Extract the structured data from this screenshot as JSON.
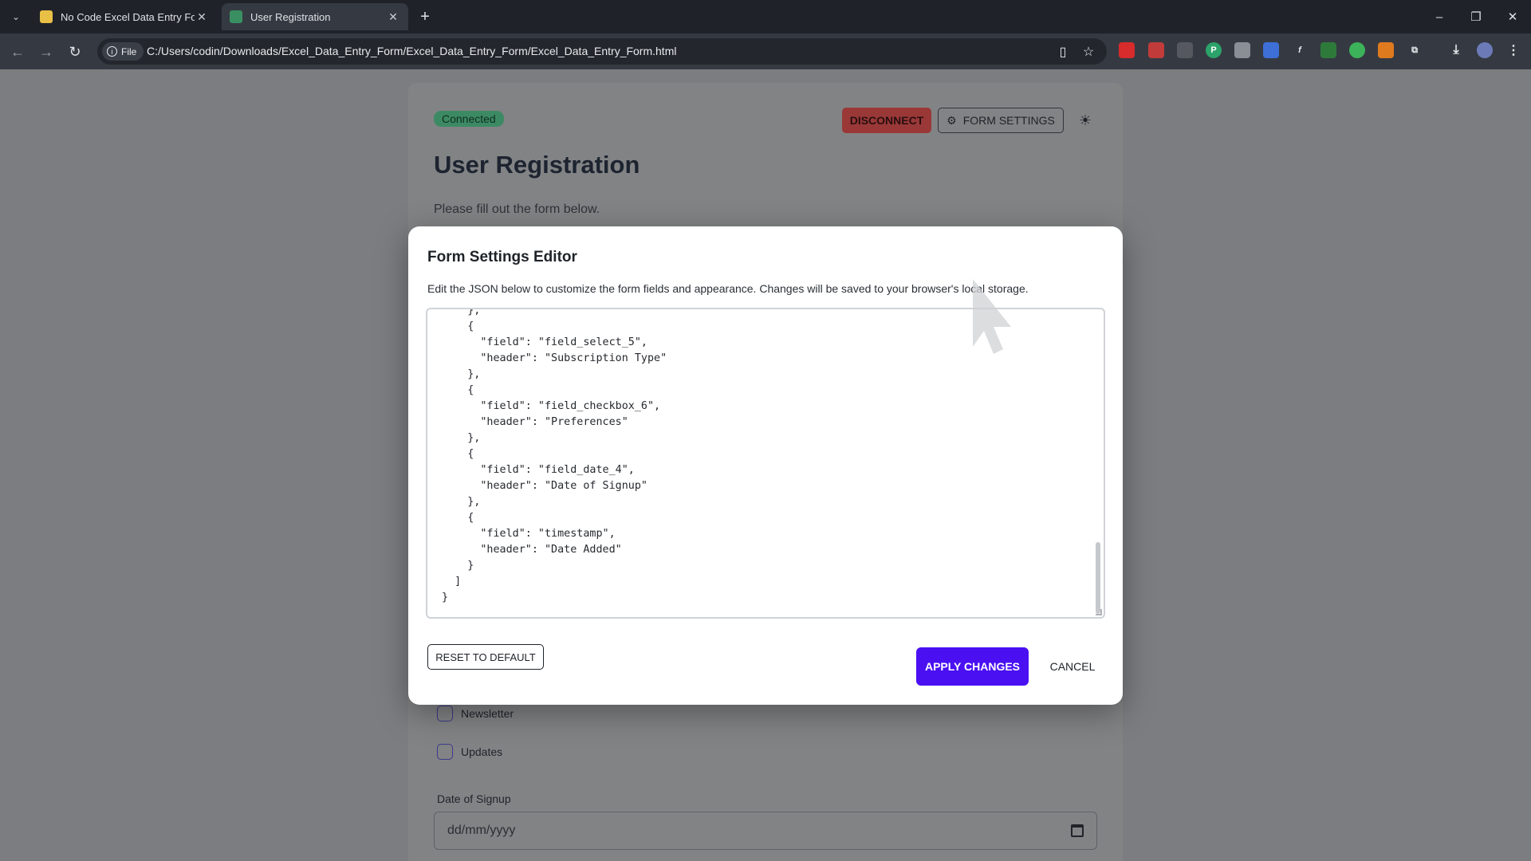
{
  "browser": {
    "tabs": [
      {
        "title": "No Code Excel Data Entry Form",
        "active": false,
        "favicon_color": "#e9c046"
      },
      {
        "title": "User Registration",
        "active": true,
        "favicon_color": "#3a8f62"
      }
    ],
    "new_tab": "+",
    "address": {
      "chip_label": "File",
      "url": "C:/Users/codin/Downloads/Excel_Data_Entry_Form/Excel_Data_Entry_Form/Excel_Data_Entry_Form.html"
    },
    "window_controls": {
      "minimize": "–",
      "restore": "❐",
      "close": "✕"
    }
  },
  "page": {
    "status_badge": "Connected",
    "disconnect_label": "DISCONNECT",
    "form_settings_label": "FORM SETTINGS",
    "title": "User Registration",
    "subtitle": "Please fill out the form below.",
    "checkboxes": [
      {
        "label": "Newsletter",
        "checked": false
      },
      {
        "label": "Updates",
        "checked": false
      }
    ],
    "date_field": {
      "label": "Date of Signup",
      "placeholder": "dd/mm/yyyy"
    }
  },
  "modal": {
    "title": "Form Settings Editor",
    "description": "Edit the JSON below to customize the form fields and appearance. Changes will be saved to your browser's local storage.",
    "json_text": "    },\n    {\n      \"field\": \"field_select_5\",\n      \"header\": \"Subscription Type\"\n    },\n    {\n      \"field\": \"field_checkbox_6\",\n      \"header\": \"Preferences\"\n    },\n    {\n      \"field\": \"field_date_4\",\n      \"header\": \"Date of Signup\"\n    },\n    {\n      \"field\": \"timestamp\",\n      \"header\": \"Date Added\"\n    }\n  ]\n}",
    "reset_label": "RESET TO DEFAULT",
    "apply_label": "APPLY CHANGES",
    "cancel_label": "CANCEL"
  },
  "colors": {
    "accent": "#4a10f2",
    "danger": "#9a3838",
    "success": "#3c8a63"
  }
}
